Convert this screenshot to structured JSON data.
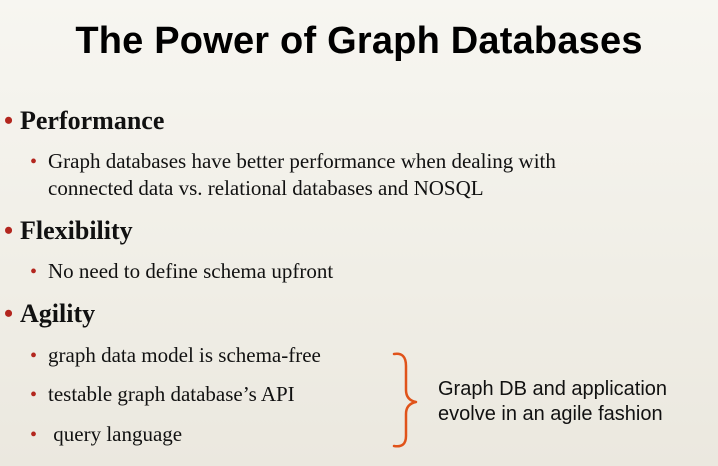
{
  "title": "The Power of Graph Databases",
  "bullet_color": "#b3261e",
  "bracket_color": "#e0531a",
  "sections": {
    "performance": {
      "heading": "Performance",
      "items": [
        {
          "line1": "Graph databases have better performance when dealing with",
          "line2": "connected data vs. relational databases and NOSQL"
        }
      ]
    },
    "flexibility": {
      "heading": "Flexibility",
      "items": [
        {
          "line1": "No need to define schema upfront"
        }
      ]
    },
    "agility": {
      "heading": "Agility",
      "items": [
        {
          "line1": "graph data model is  schema-free"
        },
        {
          "line1": "testable graph database’s API"
        },
        {
          "line1": " query language"
        }
      ]
    }
  },
  "callout": {
    "line1": "Graph DB and application",
    "line2": "evolve in an agile fashion"
  }
}
